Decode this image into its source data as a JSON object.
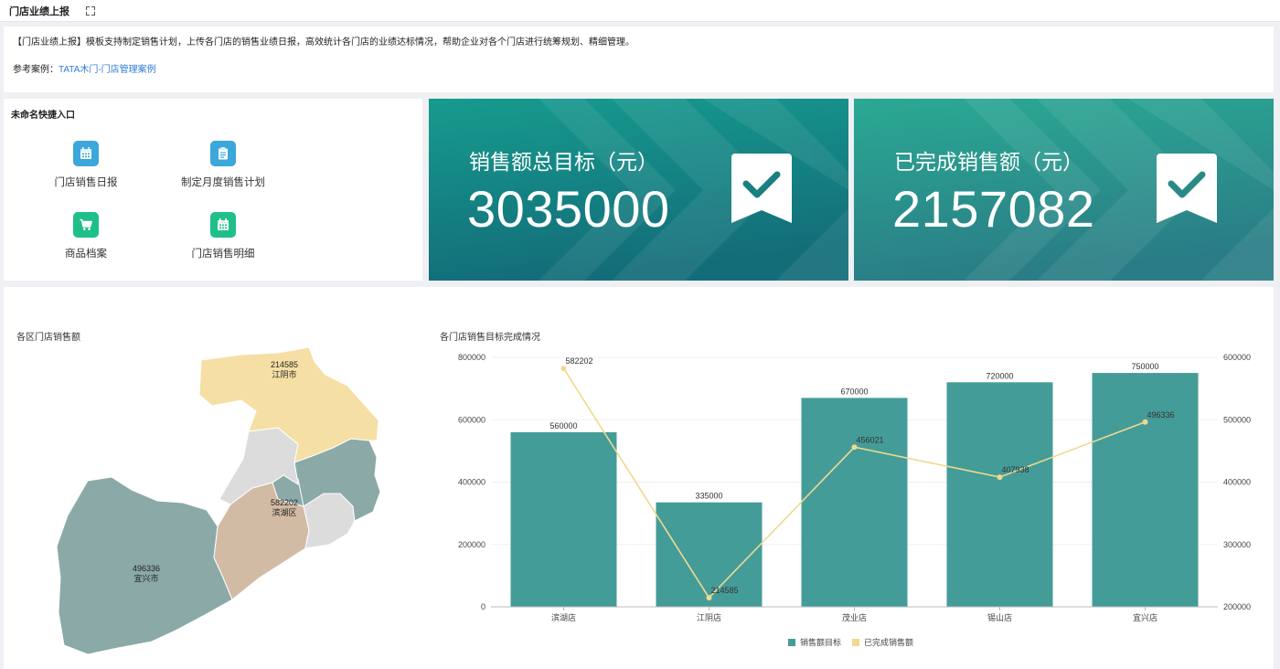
{
  "topbar": {
    "title": "门店业绩上报"
  },
  "intro": {
    "text": "【门店业绩上报】模板支持制定销售计划，上传各门店的销售业绩日报，高效统计各门店的业绩达标情况，帮助企业对各个门店进行统筹规划、精细管理。",
    "ref_label": "参考案例：",
    "ref_link": "TATA木门-门店管理案例"
  },
  "quick": {
    "title": "未命名快捷入口",
    "items": [
      {
        "label": "门店销售日报",
        "icon": "calendar-icon",
        "color": "#3ba7db"
      },
      {
        "label": "制定月度销售计划",
        "icon": "clipboard-icon",
        "color": "#3ba7db"
      },
      {
        "label": "商品档案",
        "icon": "cart-icon",
        "color": "#1fbf8a"
      },
      {
        "label": "门店销售明细",
        "icon": "calendar-icon",
        "color": "#1fbf8a"
      }
    ]
  },
  "kpis": [
    {
      "label": "销售额总目标（元）",
      "value": "3035000",
      "icon": "check-badge-icon"
    },
    {
      "label": "已完成销售额（元）",
      "value": "2157082",
      "icon": "check-badge-icon"
    }
  ],
  "map": {
    "title": "各区门店销售额",
    "regions": [
      {
        "name": "江阴市",
        "value": "214585",
        "color": "#f5dfa4"
      },
      {
        "name": "滨湖区",
        "value": "582202",
        "color": "#d2bba4"
      },
      {
        "name": "宜兴市",
        "value": "496336",
        "color": "#8aa9a7"
      }
    ]
  },
  "chart_title": "各门店销售目标完成情况",
  "colors": {
    "bar": "#449c98",
    "line": "#f0d98e"
  },
  "chart_data": {
    "type": "bar",
    "categories": [
      "滨湖店",
      "江阴店",
      "茂业店",
      "锡山店",
      "宜兴店"
    ],
    "series": [
      {
        "name": "销售额目标",
        "type": "bar",
        "axis": "left",
        "values": [
          560000,
          335000,
          670000,
          720000,
          750000
        ]
      },
      {
        "name": "已完成销售额",
        "type": "line",
        "axis": "right",
        "values": [
          582202,
          214585,
          456021,
          407938,
          496336
        ]
      }
    ],
    "ylim_left": [
      0,
      800000
    ],
    "yticks_left": [
      "0",
      "200000",
      "400000",
      "600000",
      "800000"
    ],
    "ylim_right": [
      200000,
      600000
    ],
    "yticks_right": [
      "200000",
      "300000",
      "400000",
      "500000",
      "600000"
    ],
    "legend": "bottom"
  }
}
